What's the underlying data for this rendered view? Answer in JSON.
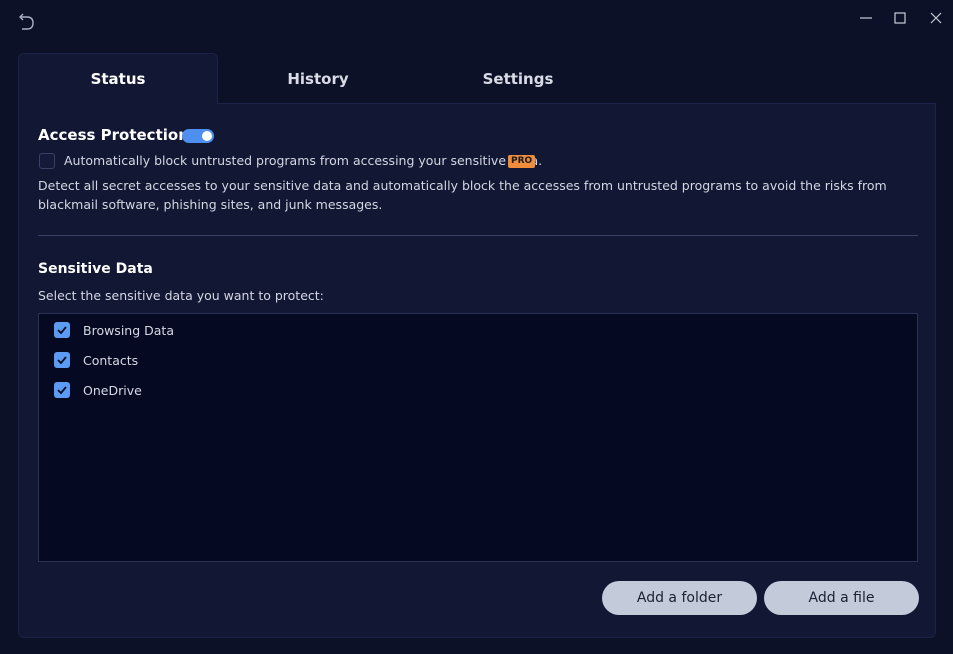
{
  "window": {
    "icons": {
      "back": "back-arrow-icon",
      "minimize": "minimize-icon",
      "maximize": "maximize-icon",
      "close": "close-icon"
    }
  },
  "tabs": [
    {
      "label": "Status",
      "active": true
    },
    {
      "label": "History",
      "active": false
    },
    {
      "label": "Settings",
      "active": false
    }
  ],
  "access_protection": {
    "title": "Access Protection",
    "enabled": true,
    "auto_block_label": "Automatically block untrusted programs from accessing your sensitive data.",
    "auto_block_checked": false,
    "pro_badge": "PRO",
    "description": "Detect all secret accesses to your sensitive data and automatically block the accesses from untrusted programs to avoid the risks from blackmail software, phishing sites, and junk messages."
  },
  "sensitive_data": {
    "title": "Sensitive Data",
    "subtitle": "Select the sensitive data you want to protect:",
    "items": [
      {
        "label": "Browsing Data",
        "checked": true
      },
      {
        "label": "Contacts",
        "checked": true
      },
      {
        "label": "OneDrive",
        "checked": true
      }
    ]
  },
  "actions": {
    "add_folder": "Add a folder",
    "add_file": "Add a file"
  },
  "colors": {
    "background": "#0d1128",
    "panel": "#121733",
    "accent": "#5c9bf3",
    "pro": "#f08d3a",
    "button": "#c3cbdb"
  }
}
